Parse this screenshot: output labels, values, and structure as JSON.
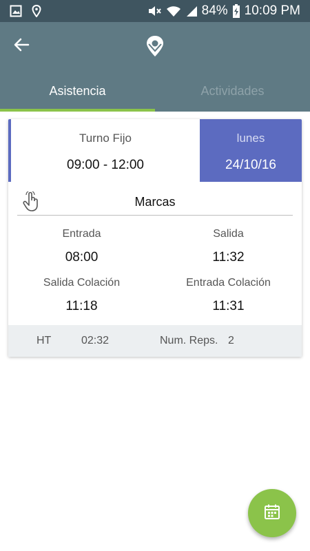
{
  "status_bar": {
    "battery": "84%",
    "time": "10:09 PM"
  },
  "app_bar": {
    "back_icon": "arrow-left-icon",
    "logo_icon": "location-pin-logo-icon"
  },
  "tabs": [
    {
      "label": "Asistencia",
      "active": true
    },
    {
      "label": "Actividades",
      "active": false
    }
  ],
  "shift": {
    "type": "Turno Fijo",
    "hours": "09:00 - 12:00",
    "day_name": "lunes",
    "date": "24/10/16"
  },
  "marcas": {
    "title": "Marcas",
    "entries": [
      {
        "label": "Entrada",
        "value": "08:00"
      },
      {
        "label": "Salida",
        "value": "11:32"
      },
      {
        "label": "Salida Colación",
        "value": "11:18"
      },
      {
        "label": "Entrada Colación",
        "value": "11:31"
      }
    ]
  },
  "summary": {
    "ht_label": "HT",
    "ht_value": "02:32",
    "reps_label": "Num. Reps.",
    "reps_value": "2"
  },
  "fab": {
    "icon": "calendar-icon"
  },
  "colors": {
    "status_bar": "#3f5560",
    "app_bar": "#5f7a84",
    "accent_green": "#8bc34a",
    "indigo": "#5c6bc0",
    "summary_bg": "#eceff1"
  }
}
